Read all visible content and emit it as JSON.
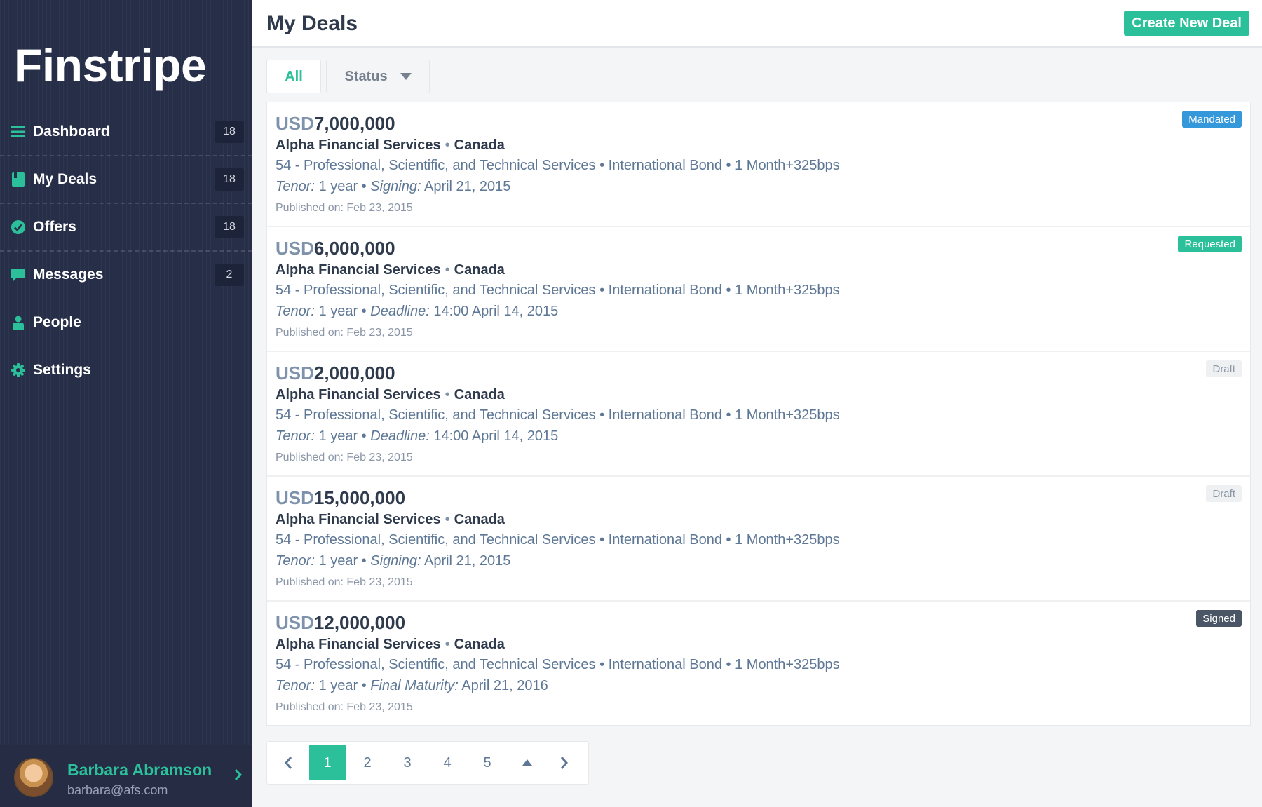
{
  "app": {
    "logo": "Finstripe",
    "accent": "#2bbf9a"
  },
  "sidebar": {
    "items": [
      {
        "label": "Dashboard",
        "icon": "list-icon",
        "count": "18"
      },
      {
        "label": "My Deals",
        "icon": "book-icon",
        "count": "18"
      },
      {
        "label": "Offers",
        "icon": "check-circle-icon",
        "count": "18"
      },
      {
        "label": "Messages",
        "icon": "chat-bubble-icon",
        "count": "2"
      },
      {
        "label": "People",
        "icon": "person-icon",
        "count": ""
      },
      {
        "label": "Settings",
        "icon": "gear-icon",
        "count": ""
      }
    ],
    "user": {
      "name": "Barbara Abramson",
      "email": "barbara@afs.com"
    }
  },
  "header": {
    "title": "My Deals",
    "create_label": "Create New Deal"
  },
  "filters": {
    "all": "All",
    "status": "Status"
  },
  "deals": [
    {
      "currency": "USD",
      "amount": "7,000,000",
      "company": "Alpha Financial Services",
      "country": "Canada",
      "sector": "54 - Professional, Scientific, and Technical Services • International Bond • 1 Month+325bps",
      "tenor_key": "Tenor:",
      "tenor_val": "1 year",
      "date_key": "Signing:",
      "date_val": "April 21, 2015",
      "published": "Published on: Feb 23, 2015",
      "status": "Mandated"
    },
    {
      "currency": "USD",
      "amount": "6,000,000",
      "company": "Alpha Financial Services",
      "country": "Canada",
      "sector": "54 - Professional, Scientific, and Technical Services • International Bond • 1 Month+325bps",
      "tenor_key": "Tenor:",
      "tenor_val": "1 year",
      "date_key": "Deadline:",
      "date_val": "14:00 April 14, 2015",
      "published": "Published on: Feb 23, 2015",
      "status": "Requested"
    },
    {
      "currency": "USD",
      "amount": "2,000,000",
      "company": "Alpha Financial Services",
      "country": "Canada",
      "sector": "54 - Professional, Scientific, and Technical Services • International Bond • 1 Month+325bps",
      "tenor_key": "Tenor:",
      "tenor_val": "1 year",
      "date_key": "Deadline:",
      "date_val": "14:00 April 14, 2015",
      "published": "Published on: Feb 23, 2015",
      "status": "Draft"
    },
    {
      "currency": "USD",
      "amount": "15,000,000",
      "company": "Alpha Financial Services",
      "country": "Canada",
      "sector": "54 - Professional, Scientific, and Technical Services • International Bond • 1 Month+325bps",
      "tenor_key": "Tenor:",
      "tenor_val": "1 year",
      "date_key": "Signing:",
      "date_val": "April 21, 2015",
      "published": "Published on: Feb 23, 2015",
      "status": "Draft"
    },
    {
      "currency": "USD",
      "amount": "12,000,000",
      "company": "Alpha Financial Services",
      "country": "Canada",
      "sector": "54 - Professional, Scientific, and Technical Services • International Bond • 1 Month+325bps",
      "tenor_key": "Tenor:",
      "tenor_val": "1 year",
      "date_key": "Final Maturity:",
      "date_val": "April 21, 2016",
      "published": "Published on: Feb 23, 2015",
      "status": "Signed"
    }
  ],
  "pagination": {
    "pages": [
      "1",
      "2",
      "3",
      "4",
      "5"
    ],
    "current": "1"
  }
}
